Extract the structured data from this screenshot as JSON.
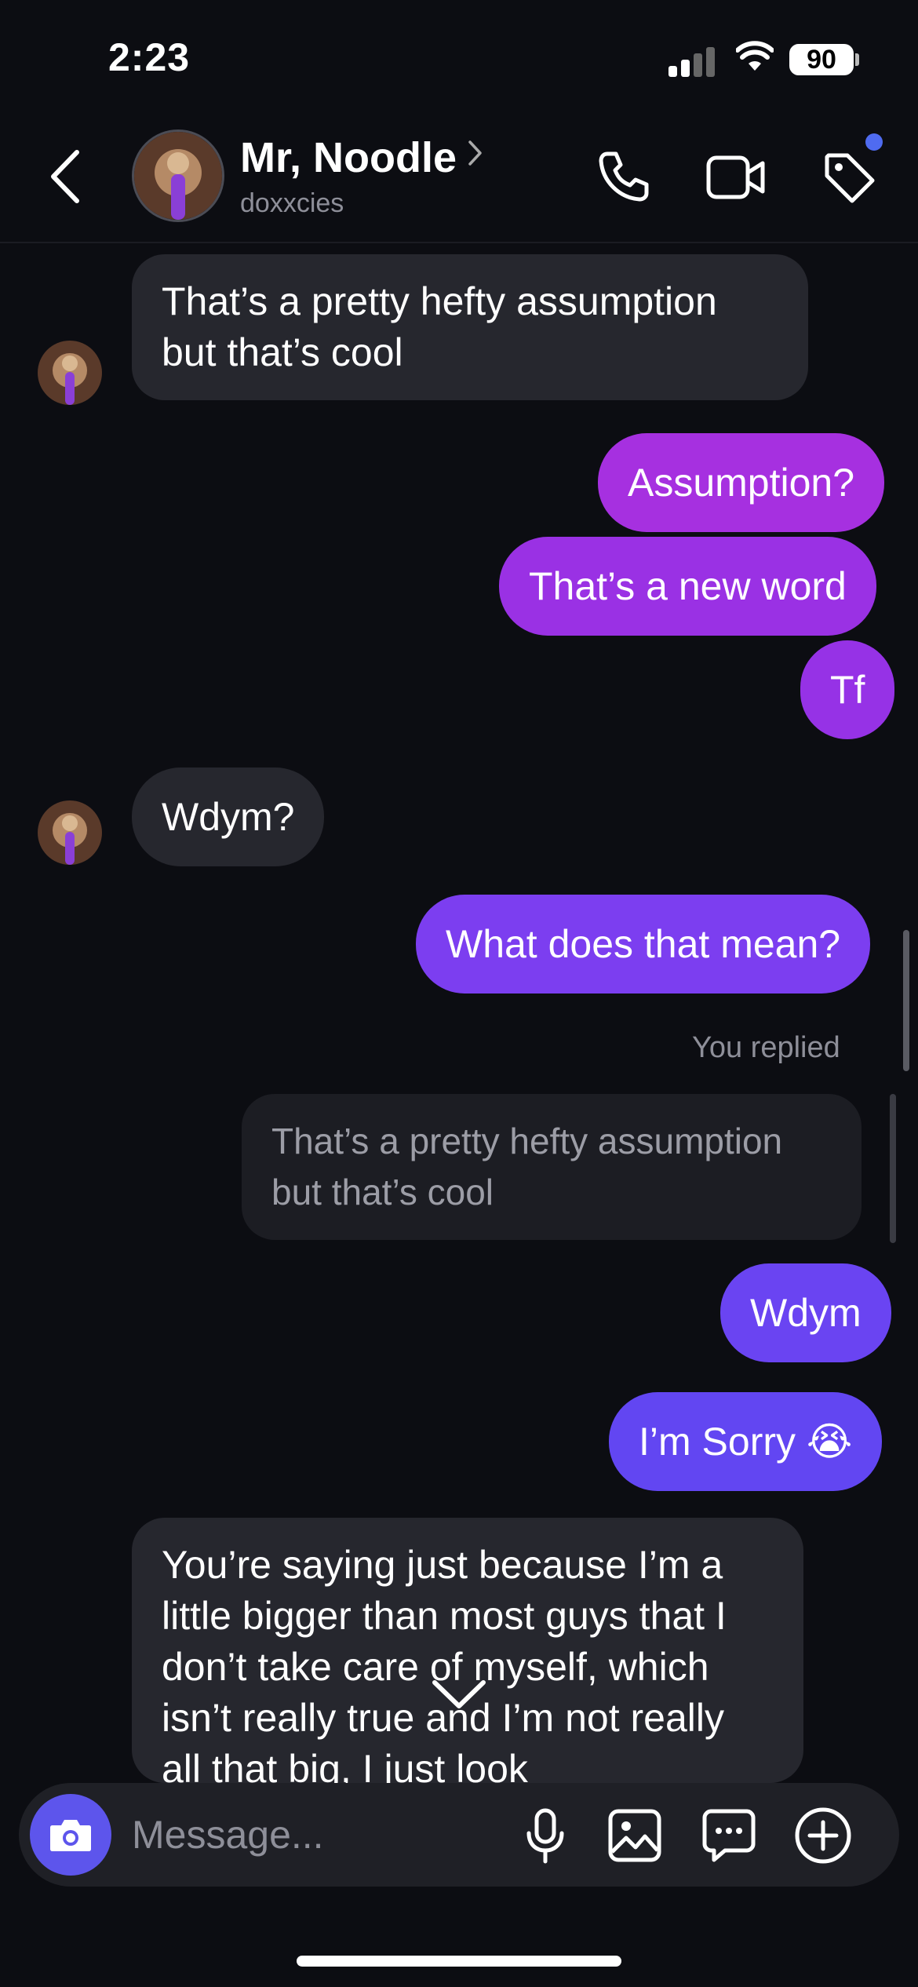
{
  "status_bar": {
    "time": "2:23",
    "battery": "90"
  },
  "header": {
    "name": "Mr, Noodle",
    "handle": "doxxcies"
  },
  "messages": {
    "m1": "That’s a pretty hefty assumption but that’s cool",
    "m2": "Assumption?",
    "m3": "That’s a new word",
    "m4": "Tf",
    "m5": "Wdym?",
    "m6": "What does that mean?",
    "reply_label": "You replied",
    "quoted": "That’s a pretty hefty assumption but that’s cool",
    "m7": "Wdym",
    "m8": "I’m Sorry 😭",
    "m9": "You’re saying just because I’m a little bigger than most guys that I don’t take care of myself, which isn’t really true and I’m not really all that big, I just look"
  },
  "composer": {
    "placeholder": "Message..."
  },
  "icons": {
    "back": "chevron-left-icon",
    "phone": "phone-icon",
    "video": "video-icon",
    "tag": "tag-icon",
    "camera": "camera-icon",
    "mic": "microphone-icon",
    "gallery": "image-icon",
    "sticker": "chat-bubble-icon",
    "plus": "plus-circle-icon"
  },
  "colors": {
    "background": "#0c0d12",
    "incoming_bubble": "#26272e",
    "outgoing_purple": "#a630e0",
    "outgoing_violet": "#7c3ef0",
    "outgoing_blue": "#6246f2",
    "camera_button": "#5d55ec",
    "notification_dot": "#4f6bf0"
  }
}
